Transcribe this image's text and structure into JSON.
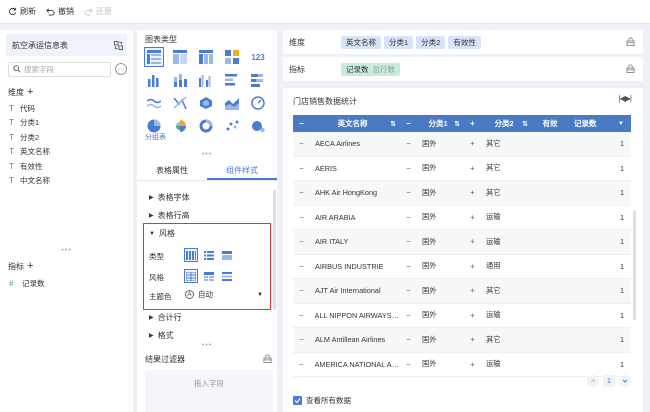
{
  "toolbar": {
    "refresh": "刷新",
    "undo": "撤销",
    "redo": "还原"
  },
  "sidebar": {
    "dataset": "航空承运信息表",
    "search_placeholder": "搜索字段",
    "dimension_title": "维度",
    "dimensions": [
      "代码",
      "分类1",
      "分类2",
      "英文名称",
      "有效性",
      "中文名称"
    ],
    "measure_title": "指标",
    "measures": [
      "记录数"
    ]
  },
  "chart_panel": {
    "title": "图表类型",
    "selected_chart_label": "分组表",
    "tabs": [
      "表格属性",
      "组件样式"
    ],
    "props": [
      "表格字体",
      "表格行高"
    ],
    "style_section": "风格",
    "type_label": "类型",
    "style_label": "风格",
    "theme_label": "主题色",
    "theme_value": "自动",
    "theme_icon_letter": "A",
    "props_after": [
      "合计行",
      "格式"
    ],
    "filter_title": "结果过滤器",
    "filter_placeholder": "拖入字段"
  },
  "shelves": {
    "dimension_label": "维度",
    "dimension_fields": [
      "英文名称",
      "分类1",
      "分类2",
      "有效性"
    ],
    "measure_label": "指标",
    "measure_field": "记录数",
    "measure_sub": "总行数"
  },
  "report": {
    "title": "门店销售数据统计",
    "headers": [
      "英文名称",
      "分类1",
      "分类2",
      "有效",
      "记录数"
    ],
    "rows": [
      {
        "name": "AECA Airlines",
        "c1": "国外",
        "c2": "其它",
        "count": "1"
      },
      {
        "name": "AERIS",
        "c1": "国外",
        "c2": "其它",
        "count": "1"
      },
      {
        "name": "AHK Air HongKong",
        "c1": "国外",
        "c2": "其它",
        "count": "1"
      },
      {
        "name": "AIR  ARABIA",
        "c1": "国外",
        "c2": "运输",
        "count": "1"
      },
      {
        "name": "AIR ITALY",
        "c1": "国外",
        "c2": "运输",
        "count": "1"
      },
      {
        "name": "AIRBUS INDUSTRIE",
        "c1": "国外",
        "c2": "通用",
        "count": "1"
      },
      {
        "name": "AJT Air International",
        "c1": "国外",
        "c2": "其它",
        "count": "1"
      },
      {
        "name": "ALL NIPPON AIRWAYS C...",
        "c1": "国外",
        "c2": "运输",
        "count": "1"
      },
      {
        "name": "ALM Antillean Airlines",
        "c1": "国外",
        "c2": "其它",
        "count": "1"
      },
      {
        "name": "AMERICA NATIONAL AIR...",
        "c1": "国外",
        "c2": "运输",
        "count": "1"
      }
    ],
    "page": "1",
    "view_all": "查看所有数据"
  },
  "colors": {
    "accent": "#4a7cd6",
    "header": "#4a7ac4",
    "highlight": "#d9363e"
  }
}
